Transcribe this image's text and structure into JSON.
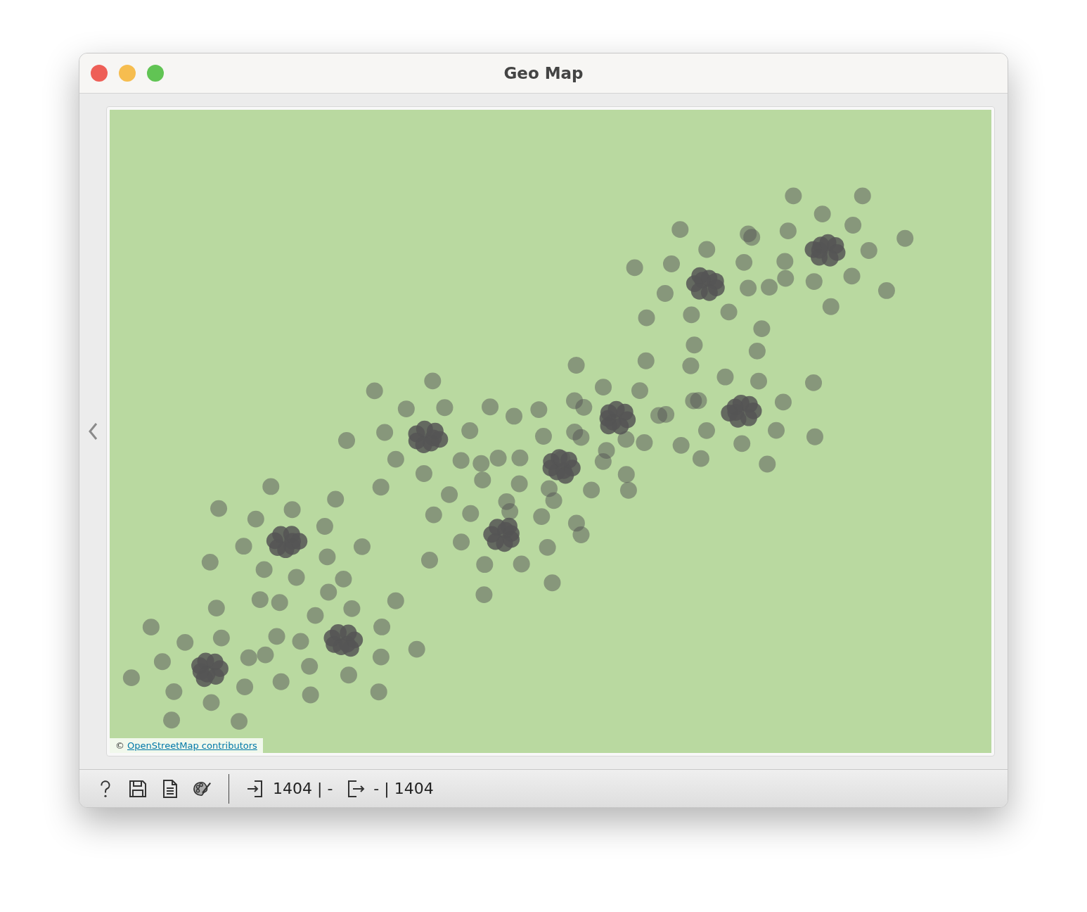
{
  "window": {
    "title": "Geo Map"
  },
  "map": {
    "attribution_prefix": "©",
    "attribution_link": "OpenStreetMap contributors"
  },
  "status_bar": {
    "input_summary": "1404 | -",
    "output_summary": "- | 1404"
  }
}
